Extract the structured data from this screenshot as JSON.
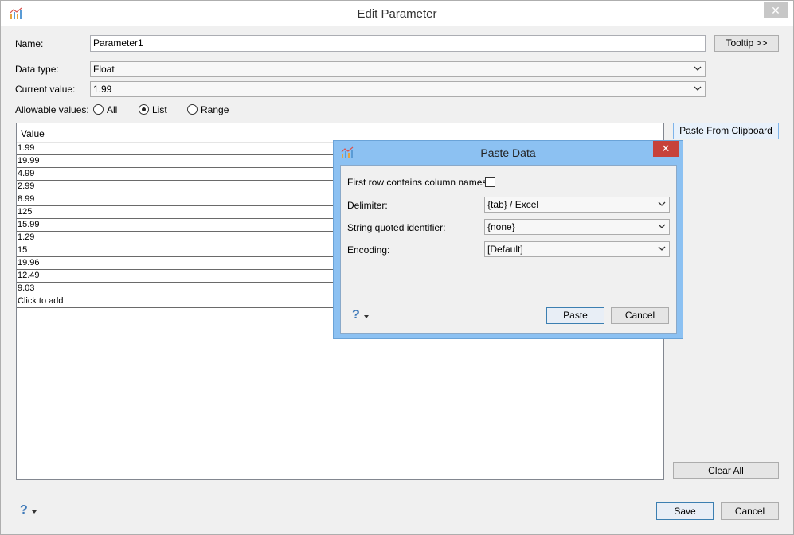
{
  "window": {
    "title": "Edit Parameter"
  },
  "form": {
    "name_label": "Name:",
    "name_value": "Parameter1",
    "tooltip_button": "Tooltip >>",
    "datatype_label": "Data type:",
    "datatype_value": "Float",
    "current_label": "Current value:",
    "current_value": "1.99",
    "allowable_label": "Allowable values:",
    "allowable_options": [
      {
        "label": "All",
        "selected": false
      },
      {
        "label": "List",
        "selected": true
      },
      {
        "label": "Range",
        "selected": false
      }
    ]
  },
  "list": {
    "header": "Value",
    "values": [
      "1.99",
      "19.99",
      "4.99",
      "2.99",
      "8.99",
      "125",
      "15.99",
      "1.29",
      "15",
      "19.96",
      "12.49",
      "9.03"
    ],
    "add_row": "Click to add"
  },
  "side_buttons": {
    "paste_clipboard": "Paste From Clipboard",
    "clear_all": "Clear All"
  },
  "footer": {
    "help": "?",
    "save": "Save",
    "cancel": "Cancel"
  },
  "paste_dialog": {
    "title": "Paste Data",
    "first_row_label": "First row contains column names:",
    "first_row_checked": false,
    "delimiter_label": "Delimiter:",
    "delimiter_value": "{tab} / Excel",
    "quoted_label": "String quoted identifier:",
    "quoted_value": "{none}",
    "encoding_label": "Encoding:",
    "encoding_value": "[Default]",
    "help": "?",
    "paste_button": "Paste",
    "cancel_button": "Cancel"
  },
  "colors": {
    "accent": "#3d78b8",
    "dialog_frame": "#8cc1f2",
    "close_red": "#c7423a"
  }
}
